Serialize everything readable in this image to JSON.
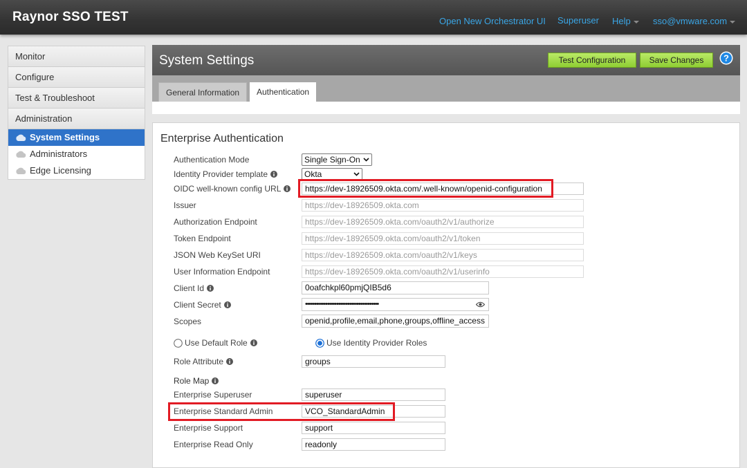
{
  "app_title": "Raynor SSO TEST",
  "topnav": {
    "orchestrator": "Open New Orchestrator UI",
    "superuser": "Superuser",
    "help": "Help",
    "user": "sso@vmware.com"
  },
  "sidebar": {
    "sections": [
      "Monitor",
      "Configure",
      "Test & Troubleshoot",
      "Administration"
    ],
    "items": [
      {
        "label": "System Settings",
        "active": true
      },
      {
        "label": "Administrators",
        "active": false
      },
      {
        "label": "Edge Licensing",
        "active": false
      }
    ]
  },
  "header": {
    "title": "System Settings",
    "test_btn": "Test Configuration",
    "save_btn": "Save Changes"
  },
  "tabs": [
    "General Information",
    "Authentication"
  ],
  "form": {
    "section_title": "Enterprise Authentication",
    "auth_mode_label": "Authentication Mode",
    "auth_mode_value": "Single Sign-On",
    "idp_template_label": "Identity Provider template",
    "idp_template_value": "Okta",
    "oidc_label": "OIDC well-known config URL",
    "oidc_value": "https://dev-18926509.okta.com/.well-known/openid-configuration",
    "issuer_label": "Issuer",
    "issuer_value": "https://dev-18926509.okta.com",
    "authz_label": "Authorization Endpoint",
    "authz_value": "https://dev-18926509.okta.com/oauth2/v1/authorize",
    "token_label": "Token Endpoint",
    "token_value": "https://dev-18926509.okta.com/oauth2/v1/token",
    "jwks_label": "JSON Web KeySet URI",
    "jwks_value": "https://dev-18926509.okta.com/oauth2/v1/keys",
    "userinfo_label": "User Information Endpoint",
    "userinfo_value": "https://dev-18926509.okta.com/oauth2/v1/userinfo",
    "client_id_label": "Client Id",
    "client_id_value": "0oafchkpl60pmjQIB5d6",
    "client_secret_label": "Client Secret",
    "client_secret_value": "••••••••••••••••••••••••••••••••••••••••",
    "scopes_label": "Scopes",
    "scopes_value": "openid,profile,email,phone,groups,offline_access",
    "default_role_label": "Use Default Role",
    "idp_roles_label": "Use Identity Provider Roles",
    "role_attr_label": "Role Attribute",
    "role_attr_value": "groups",
    "role_map_label": "Role Map",
    "superuser_label": "Enterprise Superuser",
    "superuser_value": "superuser",
    "std_admin_label": "Enterprise Standard Admin",
    "std_admin_value": "VCO_StandardAdmin",
    "support_label": "Enterprise Support",
    "support_value": "support",
    "readonly_label": "Enterprise Read Only",
    "readonly_value": "readonly"
  },
  "colors": {
    "accent_blue": "#2f73c9",
    "link_blue": "#3aa6e6",
    "button_green": "#9ad43f",
    "highlight_red": "#e21b24"
  }
}
